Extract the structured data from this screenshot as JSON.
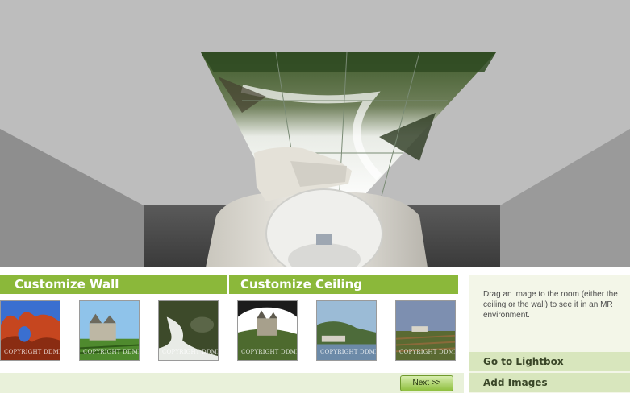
{
  "tabs": {
    "wall": "Customize Wall",
    "ceiling": "Customize Ceiling"
  },
  "thumbnails": [
    {
      "subject": "red rock arches",
      "watermark": "COPYRIGHT DDMN"
    },
    {
      "subject": "castle with vineyard",
      "watermark": "COPYRIGHT DDMN"
    },
    {
      "subject": "waterfall stream",
      "watermark": "COPYRIGHT DDMN"
    },
    {
      "subject": "castle on hill",
      "watermark": "COPYRIGHT DDMN"
    },
    {
      "subject": "river town hillside",
      "watermark": "COPYRIGHT DDMN"
    },
    {
      "subject": "vineyard field",
      "watermark": "COPYRIGHT DDMN"
    }
  ],
  "next_label": "Next  >>",
  "info_text": "Drag an image to the room (either the ceiling or the wall) to see it in an MR environment.",
  "lightbox_label": "Go to Lightbox",
  "add_images_label": "Add Images",
  "colors": {
    "accent": "#8bb83a",
    "panel": "#f3f6e8",
    "button_bg": "#d8e6bd"
  }
}
